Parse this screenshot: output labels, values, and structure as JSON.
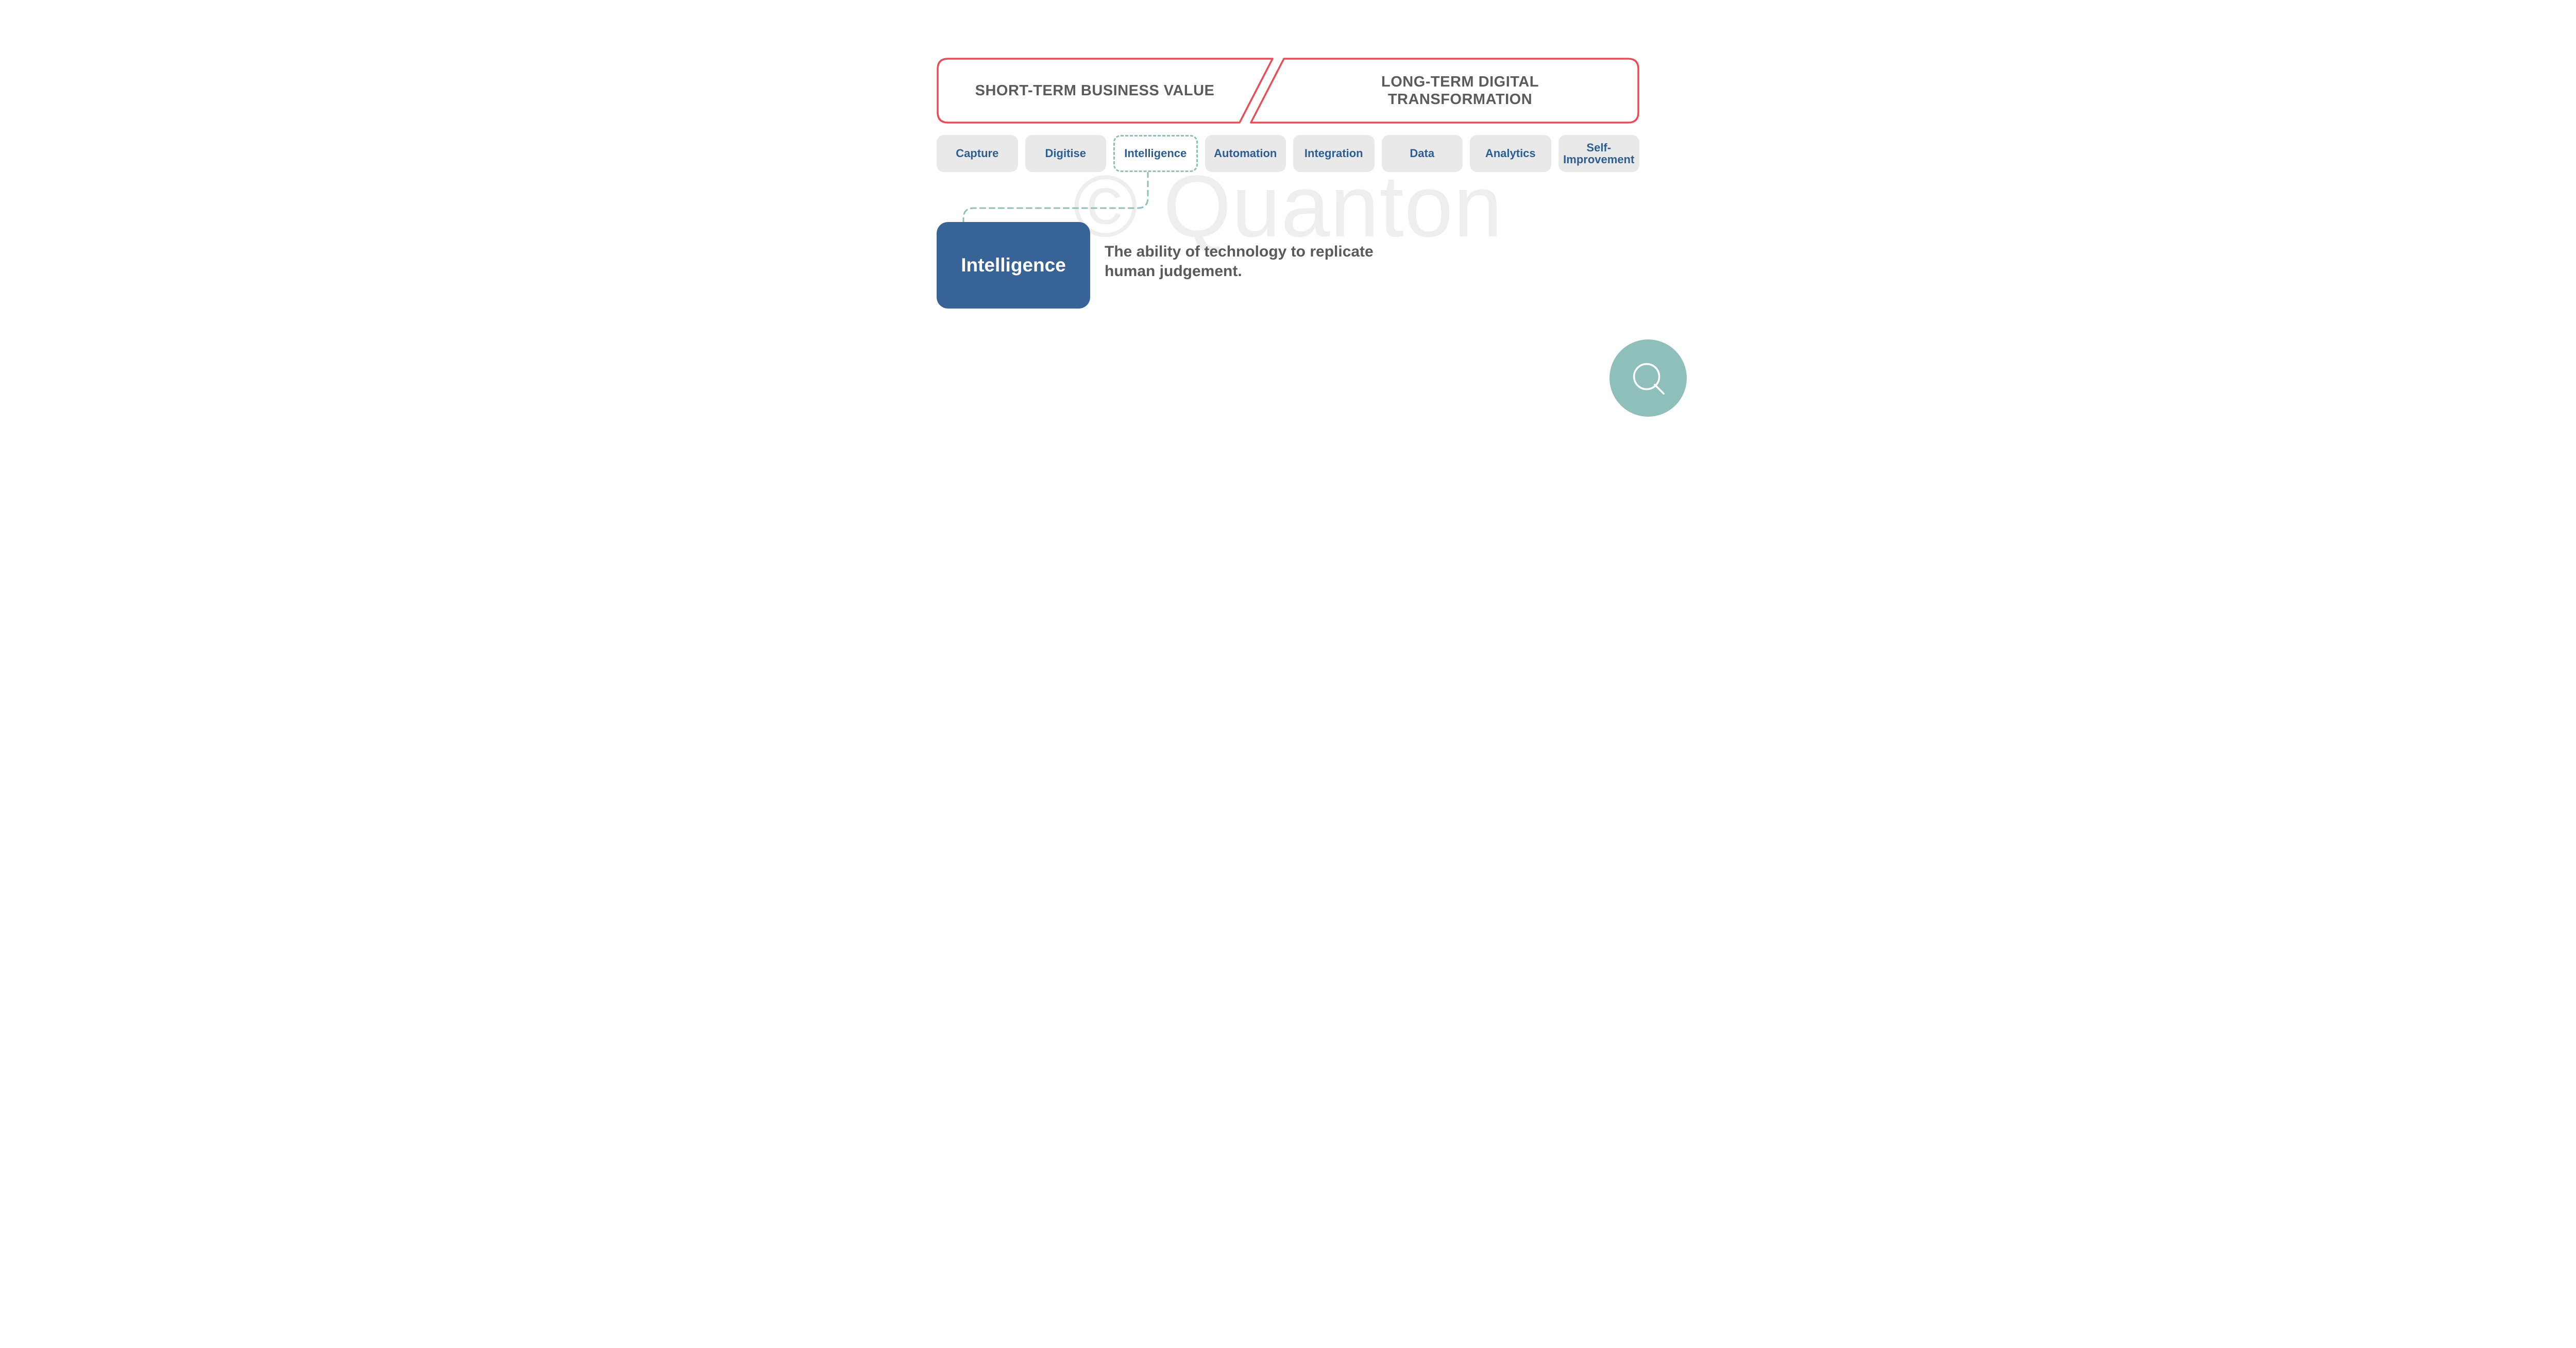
{
  "watermark": "© Quanton",
  "headers": {
    "left": "SHORT-TERM BUSINESS VALUE",
    "right": "LONG-TERM DIGITAL\nTRANSFORMATION"
  },
  "pills": [
    {
      "label": "Capture",
      "selected": false
    },
    {
      "label": "Digitise",
      "selected": false
    },
    {
      "label": "Intelligence",
      "selected": true
    },
    {
      "label": "Automation",
      "selected": false
    },
    {
      "label": "Integration",
      "selected": false
    },
    {
      "label": "Data",
      "selected": false
    },
    {
      "label": "Analytics",
      "selected": false
    },
    {
      "label": "Self-\nImprovement",
      "selected": false
    }
  ],
  "detail": {
    "title": "Intelligence",
    "description": "The ability of technology to replicate human judgement."
  },
  "colors": {
    "outline_red": "#e94b57",
    "pill_bg": "#e9e9ea",
    "pill_text": "#2c5e92",
    "dash_teal": "#8fbfbb",
    "card_blue": "#376397",
    "body_text": "#5a5a5a"
  },
  "badge_letter": "Q"
}
